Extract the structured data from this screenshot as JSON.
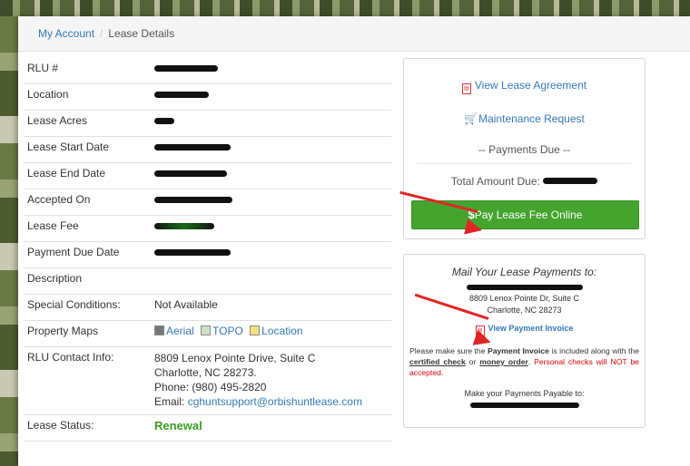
{
  "breadcrumb": {
    "home": "My Account",
    "current": "Lease Details"
  },
  "details": {
    "rlu_label": "RLU #",
    "location_label": "Location",
    "acres_label": "Lease Acres",
    "start_label": "Lease Start Date",
    "end_label": "Lease End Date",
    "accepted_label": "Accepted On",
    "fee_label": "Lease Fee",
    "due_label": "Payment Due Date",
    "description_label": "Description",
    "special_label": "Special Conditions:",
    "special_value": "Not Available",
    "maps_label": "Property Maps",
    "maps": [
      "Aerial",
      "TOPO",
      "Location"
    ],
    "contact_label": "RLU Contact Info:",
    "contact_address1": "8809 Lenox Pointe Drive, Suite C",
    "contact_address2": "Charlotte, NC 28273.",
    "contact_phone": "Phone: (980) 495-2820",
    "contact_email_prefix": "Email: ",
    "contact_email": "cghuntsupport@orbishuntlease.com",
    "status_label": "Lease Status:",
    "status_value": "Renewal"
  },
  "actions": {
    "view_lease": "View Lease Agreement",
    "maintenance": "Maintenance Request",
    "payments_due": "-- Payments Due --",
    "total_label": "Total Amount Due:",
    "pay_symbol": "$",
    "pay_label": "Pay Lease Fee Online"
  },
  "mail": {
    "heading": "Mail Your Lease Payments to:",
    "address1": "8809 Lenox Pointe Dr, Suite C",
    "address2": "Charlotte, NC 28273",
    "invoice_link": "View Payment Invoice",
    "note_1": "Please make sure the ",
    "note_invoice": "Payment Invoice",
    "note_2": " is included along with the ",
    "note_check": "certified check",
    "note_or": " or ",
    "note_mo": "money order",
    "note_3": ". ",
    "note_red": "Personal checks will NOT be accepted.",
    "payable_to": "Make your Payments Payable to:"
  },
  "colors": {
    "pay_button": "#45a42e",
    "link": "#337ab7",
    "alert": "#e12424",
    "status_green": "#3a9d23"
  }
}
